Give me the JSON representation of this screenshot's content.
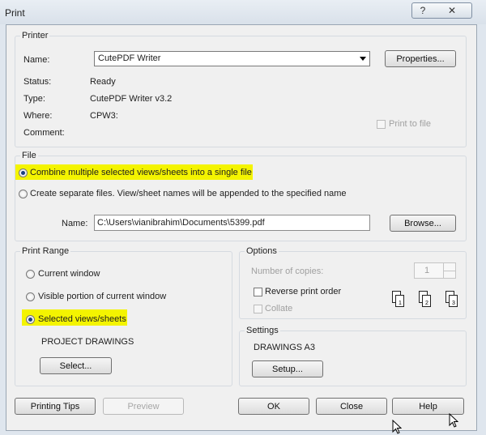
{
  "window": {
    "title": "Print",
    "help_glyph": "?",
    "close_glyph": "✕"
  },
  "printer": {
    "group_label": "Printer",
    "name_label": "Name:",
    "name_value": "CutePDF Writer",
    "properties_button": "Properties...",
    "status_label": "Status:",
    "status_value": "Ready",
    "type_label": "Type:",
    "type_value": "CutePDF Writer v3.2",
    "where_label": "Where:",
    "where_value": "CPW3:",
    "comment_label": "Comment:",
    "print_to_file_label": "Print to file"
  },
  "file": {
    "group_label": "File",
    "combine_label": "Combine multiple selected views/sheets into a single file",
    "separate_label": "Create separate files. View/sheet names will be appended to the specified name",
    "name_label": "Name:",
    "name_value": "C:\\Users\\vianibrahim\\Documents\\5399.pdf",
    "browse_button": "Browse..."
  },
  "print_range": {
    "group_label": "Print Range",
    "current_window_label": "Current window",
    "visible_portion_label": "Visible portion of current window",
    "selected_label": "Selected views/sheets",
    "selected_set": "PROJECT DRAWINGS",
    "select_button": "Select..."
  },
  "options": {
    "group_label": "Options",
    "copies_label": "Number of copies:",
    "copies_value": "1",
    "reverse_label": "Reverse print order",
    "collate_label": "Collate",
    "collate_page_1": "1",
    "collate_page_2": "2",
    "collate_page_3": "3"
  },
  "settings": {
    "group_label": "Settings",
    "value": "DRAWINGS A3",
    "setup_button": "Setup..."
  },
  "footer": {
    "printing_tips_button": "Printing Tips",
    "preview_button": "Preview",
    "ok_button": "OK",
    "close_button": "Close",
    "help_button": "Help"
  },
  "colors": {
    "highlight": "#f4f400",
    "radio_dot": "#1b3f7d",
    "title_bar": "#e9eef4"
  }
}
